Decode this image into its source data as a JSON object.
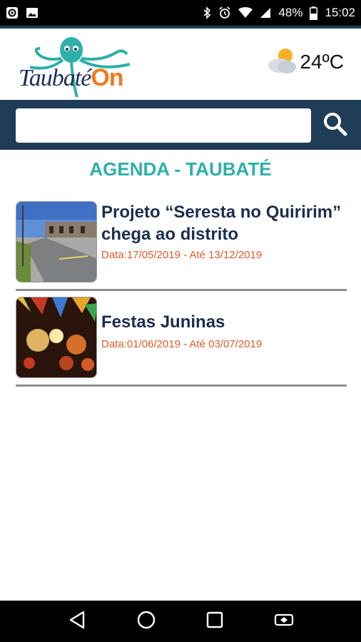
{
  "status_bar": {
    "battery_percent": "48%",
    "time": "15:02",
    "icons": [
      "at-sign-icon",
      "image-icon",
      "bluetooth-icon",
      "alarm-icon",
      "wifi-icon",
      "signal-icon",
      "battery-icon"
    ]
  },
  "header": {
    "logo": {
      "text_main": "Taubaté",
      "text_accent": "On"
    },
    "weather": {
      "icon": "partly-cloudy-icon",
      "temperature": "24ºC"
    }
  },
  "search": {
    "placeholder": "",
    "value": "",
    "button_icon": "search-icon"
  },
  "page": {
    "title": "AGENDA - TAUBATÉ"
  },
  "events": [
    {
      "title": "Projeto “Seresta no Quiririm” chega ao distrito",
      "date": "Data:17/05/2019 - Até 13/12/2019",
      "image": "street-photo"
    },
    {
      "title": "Festas Juninas",
      "date": "Data:01/06/2019 - Até 03/07/2019",
      "image": "festival-photo"
    }
  ],
  "nav_bar": {
    "buttons": [
      "back-icon",
      "home-icon",
      "recents-icon",
      "screen-rotate-icon"
    ]
  },
  "colors": {
    "primary": "#1f3d57",
    "title_teal": "#2db0a8",
    "date_orange": "#e05a2a",
    "event_title": "#1c2d4e",
    "logo_orange": "#f07a1e"
  }
}
